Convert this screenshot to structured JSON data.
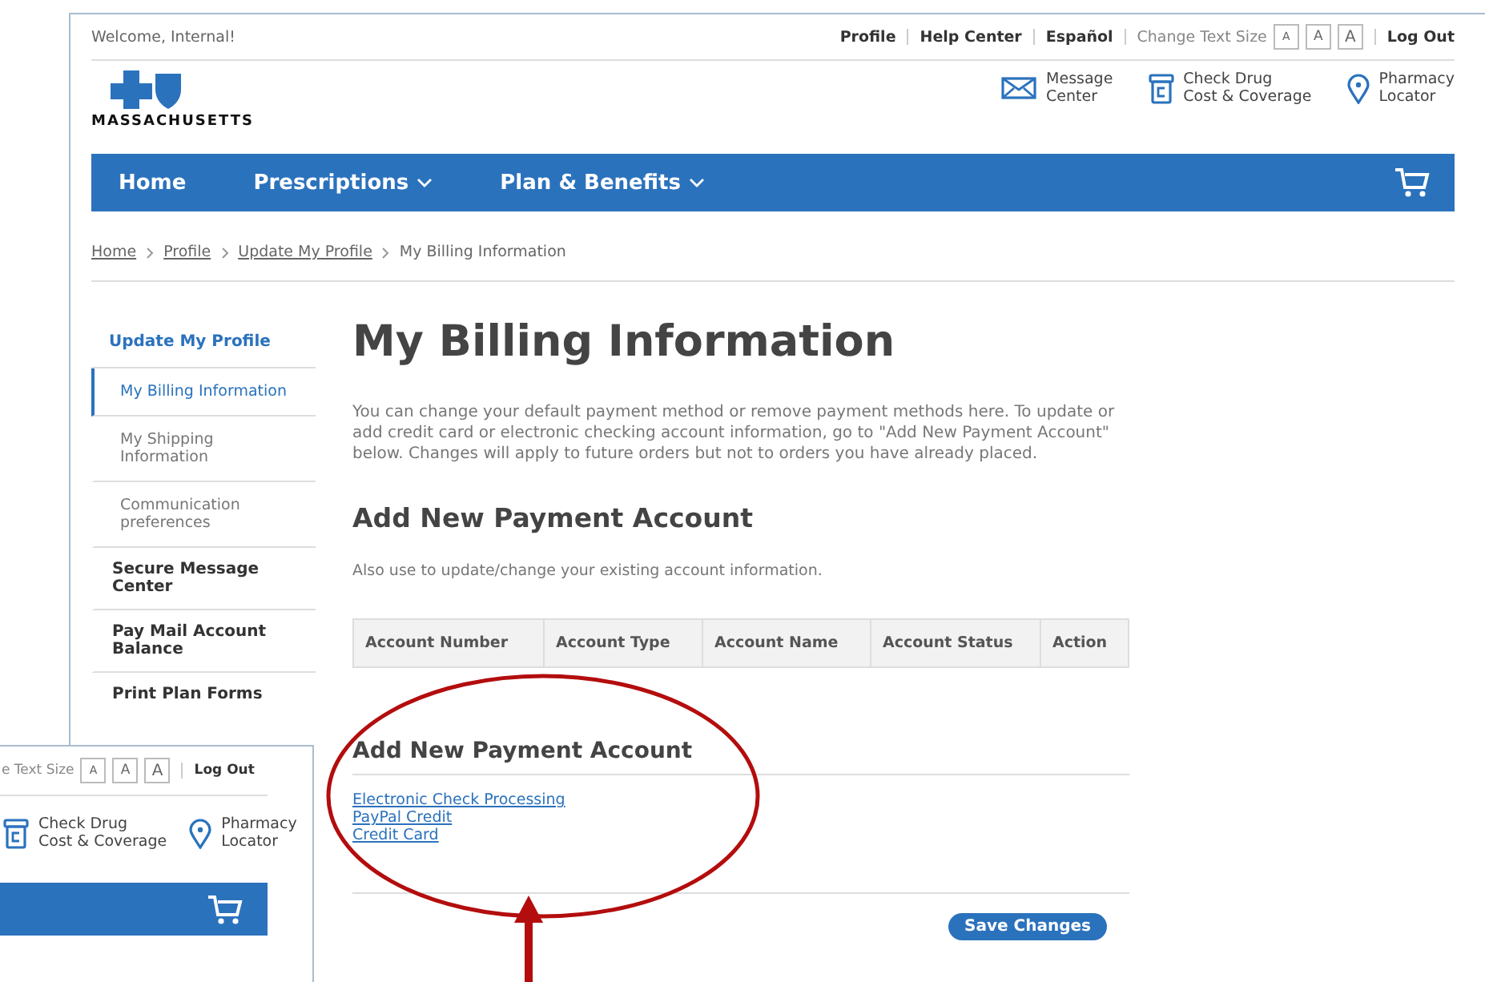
{
  "top_bar": {
    "welcome": "Welcome, Internal!",
    "links": [
      "Profile",
      "Help Center",
      "Español"
    ],
    "text_size_label": "Change Text Size",
    "size_buttons": [
      "A",
      "A",
      "A"
    ],
    "logout": "Log Out"
  },
  "header": {
    "logo_text": "MASSACHUSETTS",
    "quick_links": [
      {
        "kind": "mail",
        "lines": [
          "Message",
          "Center"
        ]
      },
      {
        "kind": "drug",
        "lines": [
          "Check Drug",
          "Cost & Coverage"
        ]
      },
      {
        "kind": "pin",
        "lines": [
          "Pharmacy",
          "Locator"
        ]
      }
    ]
  },
  "nav": {
    "items": [
      {
        "label": "Home",
        "dropdown": false
      },
      {
        "label": "Prescriptions",
        "dropdown": true
      },
      {
        "label": "Plan & Benefits",
        "dropdown": true
      }
    ]
  },
  "breadcrumb": [
    {
      "label": "Home",
      "link": true
    },
    {
      "label": "Profile",
      "link": true
    },
    {
      "label": "Update My Profile",
      "link": true
    },
    {
      "label": "My Billing Information",
      "link": false
    }
  ],
  "sidebar": {
    "heading": "Update My Profile",
    "items": [
      {
        "label": "My Billing Information",
        "kind": "sub",
        "selected": true
      },
      {
        "label": "My Shipping Information",
        "kind": "sub",
        "selected": false
      },
      {
        "label": "Communication preferences",
        "kind": "sub",
        "selected": false
      },
      {
        "label": "Secure Message Center",
        "kind": "main",
        "selected": false
      },
      {
        "label": "Pay Mail Account Balance",
        "kind": "main",
        "selected": false
      },
      {
        "label": "Print Plan Forms",
        "kind": "main",
        "selected": false
      }
    ]
  },
  "main": {
    "title": "My Billing Information",
    "intro": "You can change your default payment method or remove payment methods here. To update or add credit card or electronic checking account information, go to \"Add New Payment Account\" below. Changes will apply to future orders but not to orders you have already placed.",
    "section_title": "Add New Payment Account",
    "section_note": "Also use to update/change your existing account information.",
    "table": {
      "columns": [
        "Account Number",
        "Account Type",
        "Account Name",
        "Account Status",
        "Action"
      ]
    },
    "add_title": "Add New Payment Account",
    "add_links": [
      "Electronic Check Processing",
      "PayPal Credit",
      "Credit Card"
    ],
    "save_button": "Save Changes"
  },
  "inset": {
    "text_size_label": "e Text Size",
    "size_buttons": [
      "A",
      "A",
      "A"
    ],
    "logout": "Log Out",
    "quick_links": [
      {
        "kind": "drug",
        "lines": [
          "Check Drug",
          "Cost & Coverage"
        ]
      },
      {
        "kind": "pin",
        "lines": [
          "Pharmacy",
          "Locator"
        ]
      }
    ]
  }
}
